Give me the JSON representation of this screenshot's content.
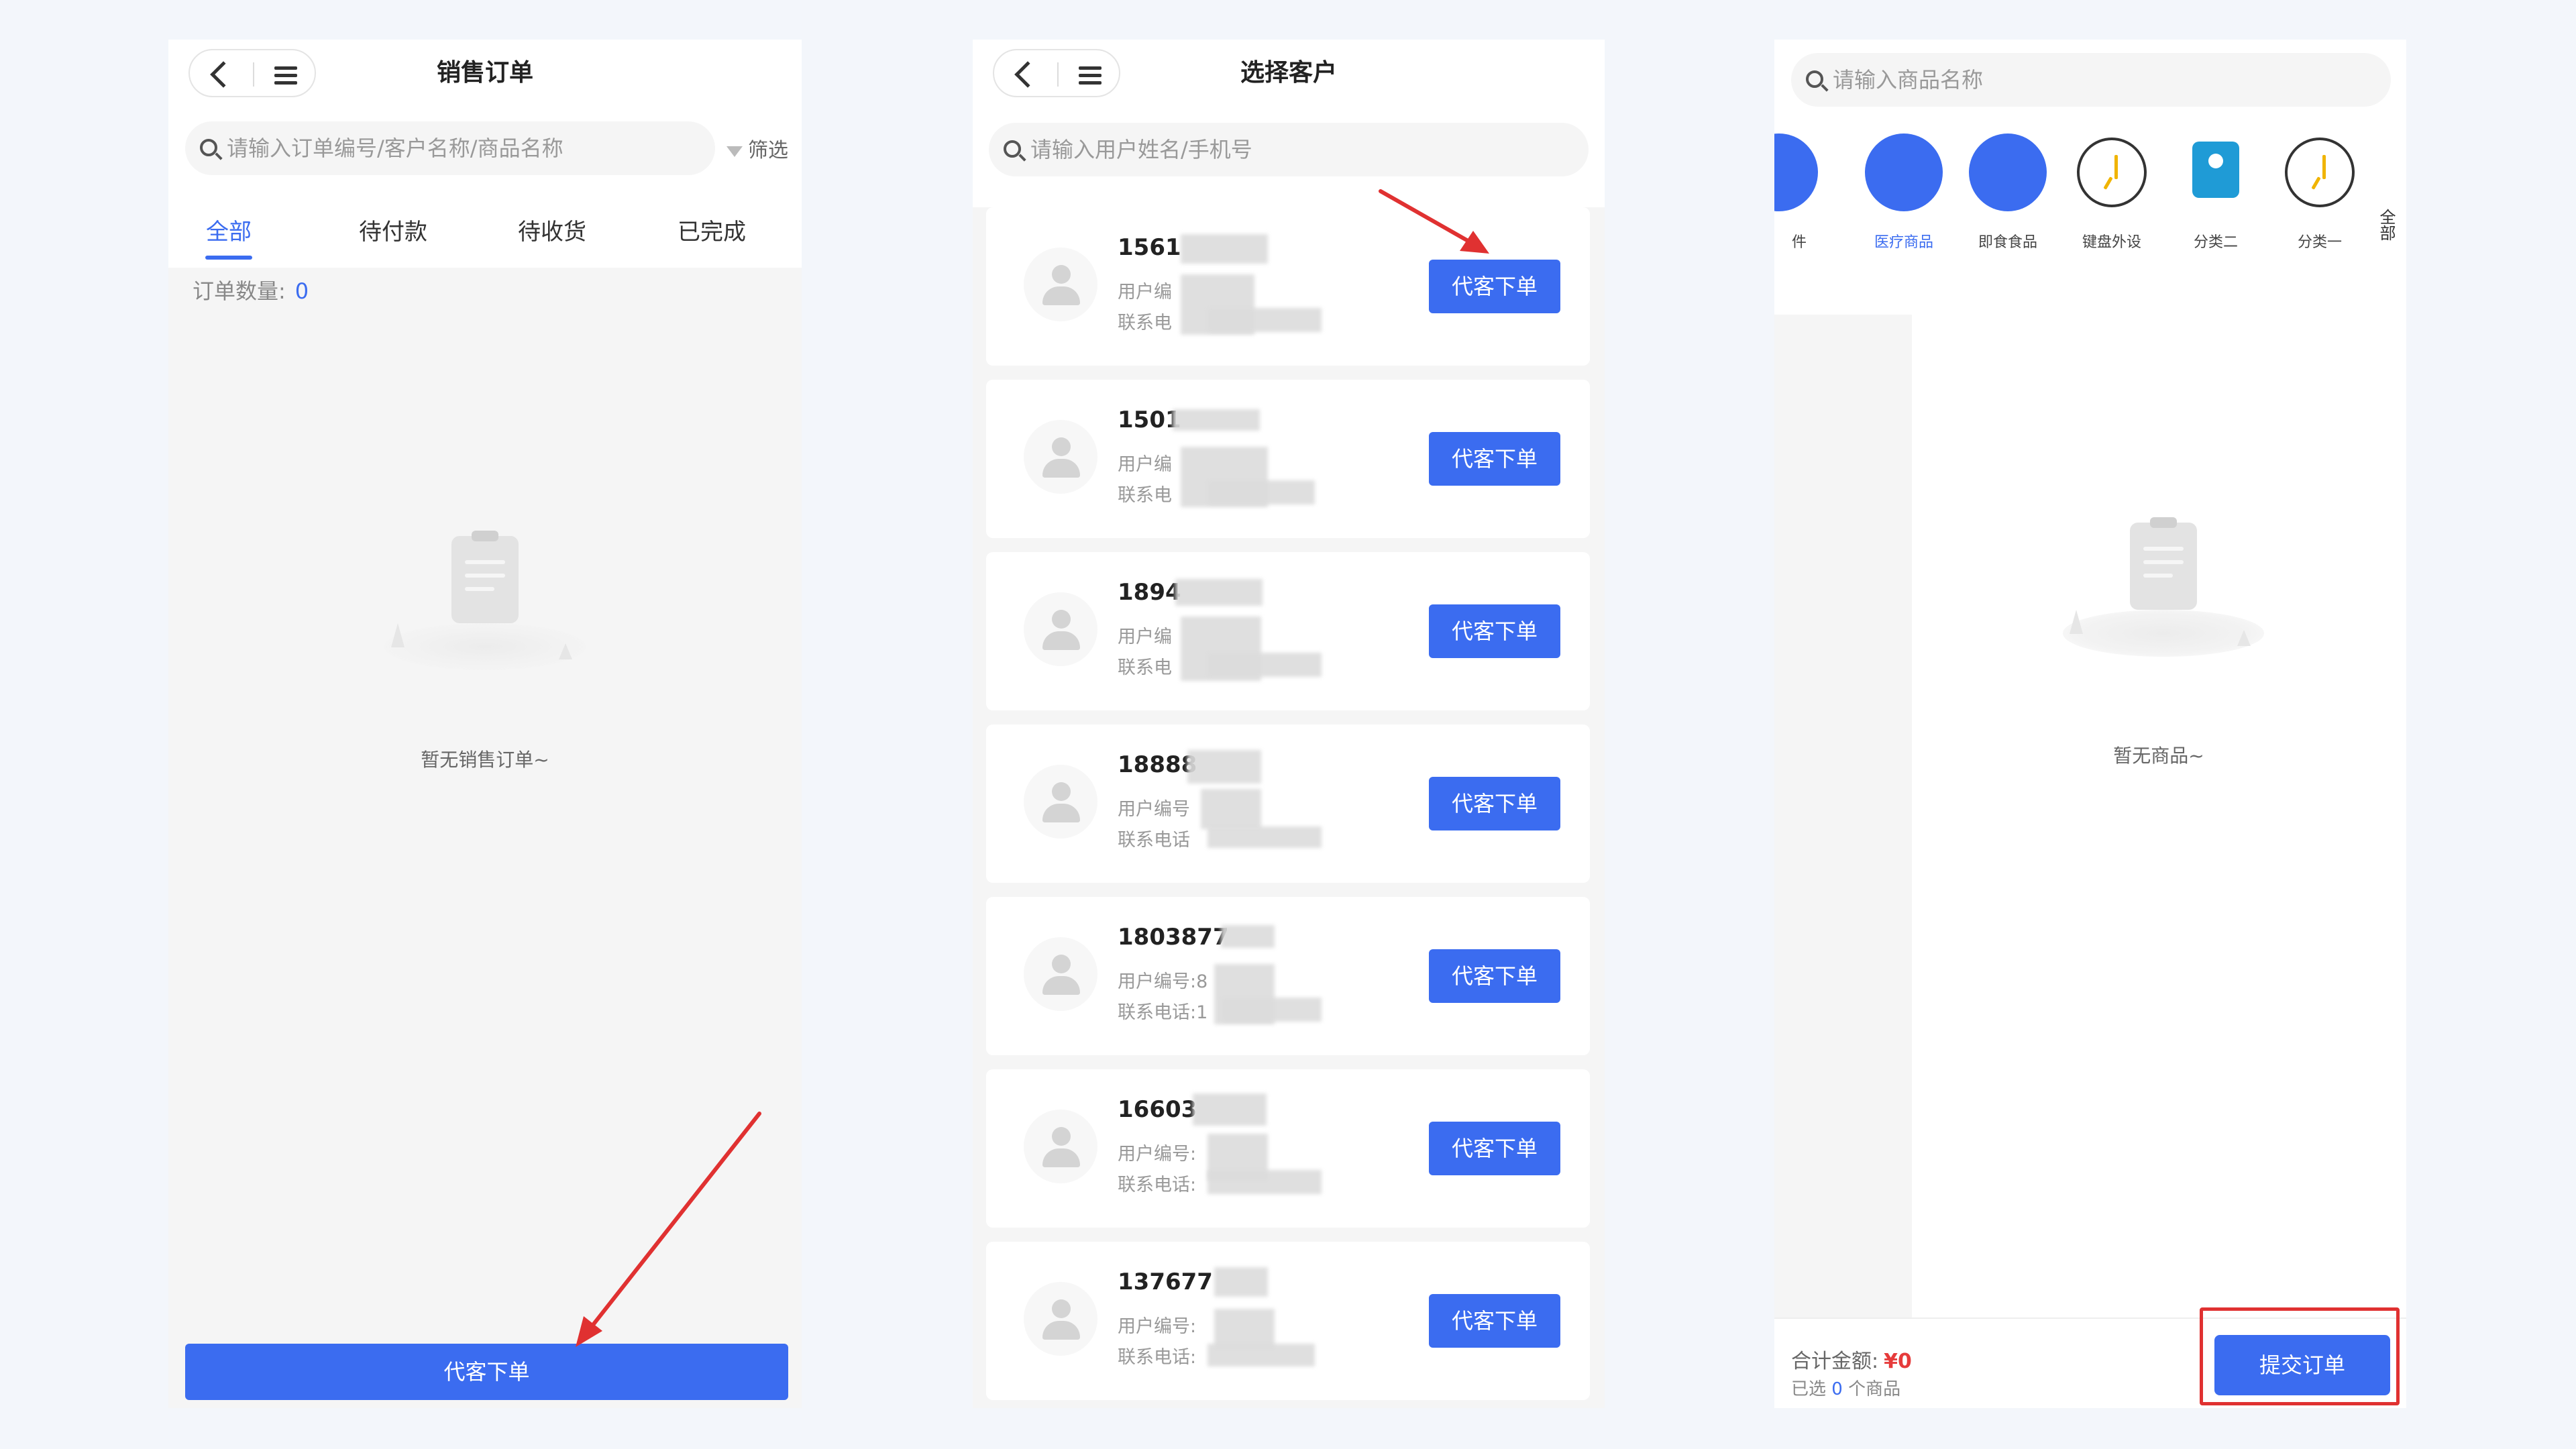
{
  "orders": {
    "title": "销售订单",
    "search_placeholder": "请输入订单编号/客户名称/商品名称",
    "filter_label": "筛选",
    "tabs": [
      "全部",
      "待付款",
      "待收货",
      "已完成"
    ],
    "count_label": "订单数量:",
    "count_value": "0",
    "empty_text": "暂无销售订单~",
    "button_label": "代客下单"
  },
  "customers": {
    "title": "选择客户",
    "search_placeholder": "请输入用户姓名/手机号",
    "button_label": "代客下单",
    "user_no_label": "用户编号:",
    "phone_label": "联系电话:",
    "items": [
      {
        "name": "1561",
        "no_label": "用户编",
        "phone_label": "联系电"
      },
      {
        "name": "1501",
        "no_label": "用户编",
        "phone_label": "联系电"
      },
      {
        "name": "1894",
        "no_label": "用户编",
        "phone_label": "联系电"
      },
      {
        "name": "18888",
        "no_label": "用户编号",
        "phone_label": "联系电话"
      },
      {
        "name": "1803877",
        "no_label": "用户编号:8",
        "phone_label": "联系电话:1"
      },
      {
        "name": "16603",
        "no_label": "用户编号:",
        "phone_label": "联系电话:"
      },
      {
        "name": "137677",
        "no_label": "用户编号:",
        "phone_label": "联系电话:"
      }
    ]
  },
  "products": {
    "search_placeholder": "请输入商品名称",
    "categories": [
      {
        "label": "件",
        "icon": "blue-circle-icon"
      },
      {
        "label": "医疗商品",
        "icon": "blue-circle-icon",
        "active": true
      },
      {
        "label": "即食食品",
        "icon": "blue-circle-icon"
      },
      {
        "label": "键盘外设",
        "icon": "clock-icon"
      },
      {
        "label": "分类二",
        "icon": "contact-book-icon"
      },
      {
        "label": "分类一",
        "icon": "clock-icon"
      }
    ],
    "all_label": "全部",
    "empty_text": "暂无商品~",
    "total_label": "合计金额:",
    "total_value": "¥0",
    "selected_prefix": "已选",
    "selected_count": "0",
    "selected_suffix": "个商品",
    "submit_label": "提交订单"
  },
  "colors": {
    "accent": "#3b6cf0",
    "annotation": "#e03131",
    "price": "#e63b3b"
  }
}
